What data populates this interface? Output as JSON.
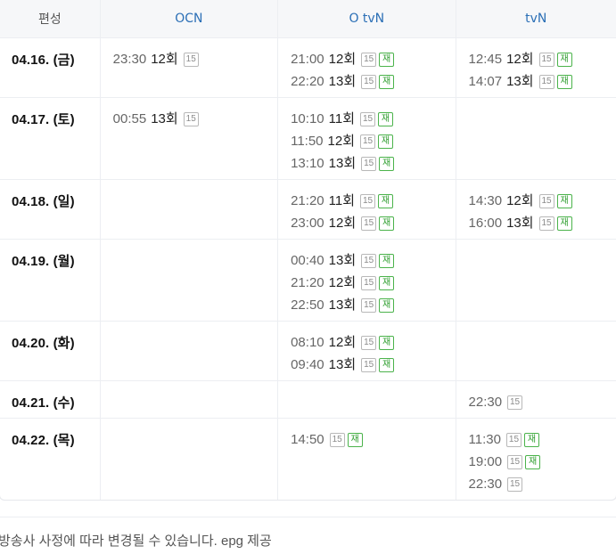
{
  "header": {
    "date_col": "편성",
    "channels": [
      "OCN",
      "O tvN",
      "tvN"
    ]
  },
  "rows": [
    {
      "date": "04.16. (금)",
      "cells": [
        [
          {
            "time": "23:30",
            "ep": "12회",
            "age": "15",
            "re": ""
          }
        ],
        [
          {
            "time": "21:00",
            "ep": "12회",
            "age": "15",
            "re": "재"
          },
          {
            "time": "22:20",
            "ep": "13회",
            "age": "15",
            "re": "재"
          }
        ],
        [
          {
            "time": "12:45",
            "ep": "12회",
            "age": "15",
            "re": "재"
          },
          {
            "time": "14:07",
            "ep": "13회",
            "age": "15",
            "re": "재"
          }
        ]
      ]
    },
    {
      "date": "04.17. (토)",
      "cells": [
        [
          {
            "time": "00:55",
            "ep": "13회",
            "age": "15",
            "re": ""
          }
        ],
        [
          {
            "time": "10:10",
            "ep": "11회",
            "age": "15",
            "re": "재"
          },
          {
            "time": "11:50",
            "ep": "12회",
            "age": "15",
            "re": "재"
          },
          {
            "time": "13:10",
            "ep": "13회",
            "age": "15",
            "re": "재"
          }
        ],
        []
      ]
    },
    {
      "date": "04.18. (일)",
      "cells": [
        [],
        [
          {
            "time": "21:20",
            "ep": "11회",
            "age": "15",
            "re": "재"
          },
          {
            "time": "23:00",
            "ep": "12회",
            "age": "15",
            "re": "재"
          }
        ],
        [
          {
            "time": "14:30",
            "ep": "12회",
            "age": "15",
            "re": "재"
          },
          {
            "time": "16:00",
            "ep": "13회",
            "age": "15",
            "re": "재"
          }
        ]
      ]
    },
    {
      "date": "04.19. (월)",
      "cells": [
        [],
        [
          {
            "time": "00:40",
            "ep": "13회",
            "age": "15",
            "re": "재"
          },
          {
            "time": "21:20",
            "ep": "12회",
            "age": "15",
            "re": "재"
          },
          {
            "time": "22:50",
            "ep": "13회",
            "age": "15",
            "re": "재"
          }
        ],
        []
      ]
    },
    {
      "date": "04.20. (화)",
      "cells": [
        [],
        [
          {
            "time": "08:10",
            "ep": "12회",
            "age": "15",
            "re": "재"
          },
          {
            "time": "09:40",
            "ep": "13회",
            "age": "15",
            "re": "재"
          }
        ],
        []
      ]
    },
    {
      "date": "04.21. (수)",
      "cells": [
        [],
        [],
        [
          {
            "time": "22:30",
            "ep": "",
            "age": "15",
            "re": ""
          }
        ]
      ]
    },
    {
      "date": "04.22. (목)",
      "cells": [
        [],
        [
          {
            "time": "14:50",
            "ep": "",
            "age": "15",
            "re": "재"
          }
        ],
        [
          {
            "time": "11:30",
            "ep": "",
            "age": "15",
            "re": "재"
          },
          {
            "time": "19:00",
            "ep": "",
            "age": "15",
            "re": "재"
          },
          {
            "time": "22:30",
            "ep": "",
            "age": "15",
            "re": ""
          }
        ]
      ]
    }
  ],
  "notice": "방송사 사정에 따라 변경될 수 있습니다. epg 제공"
}
